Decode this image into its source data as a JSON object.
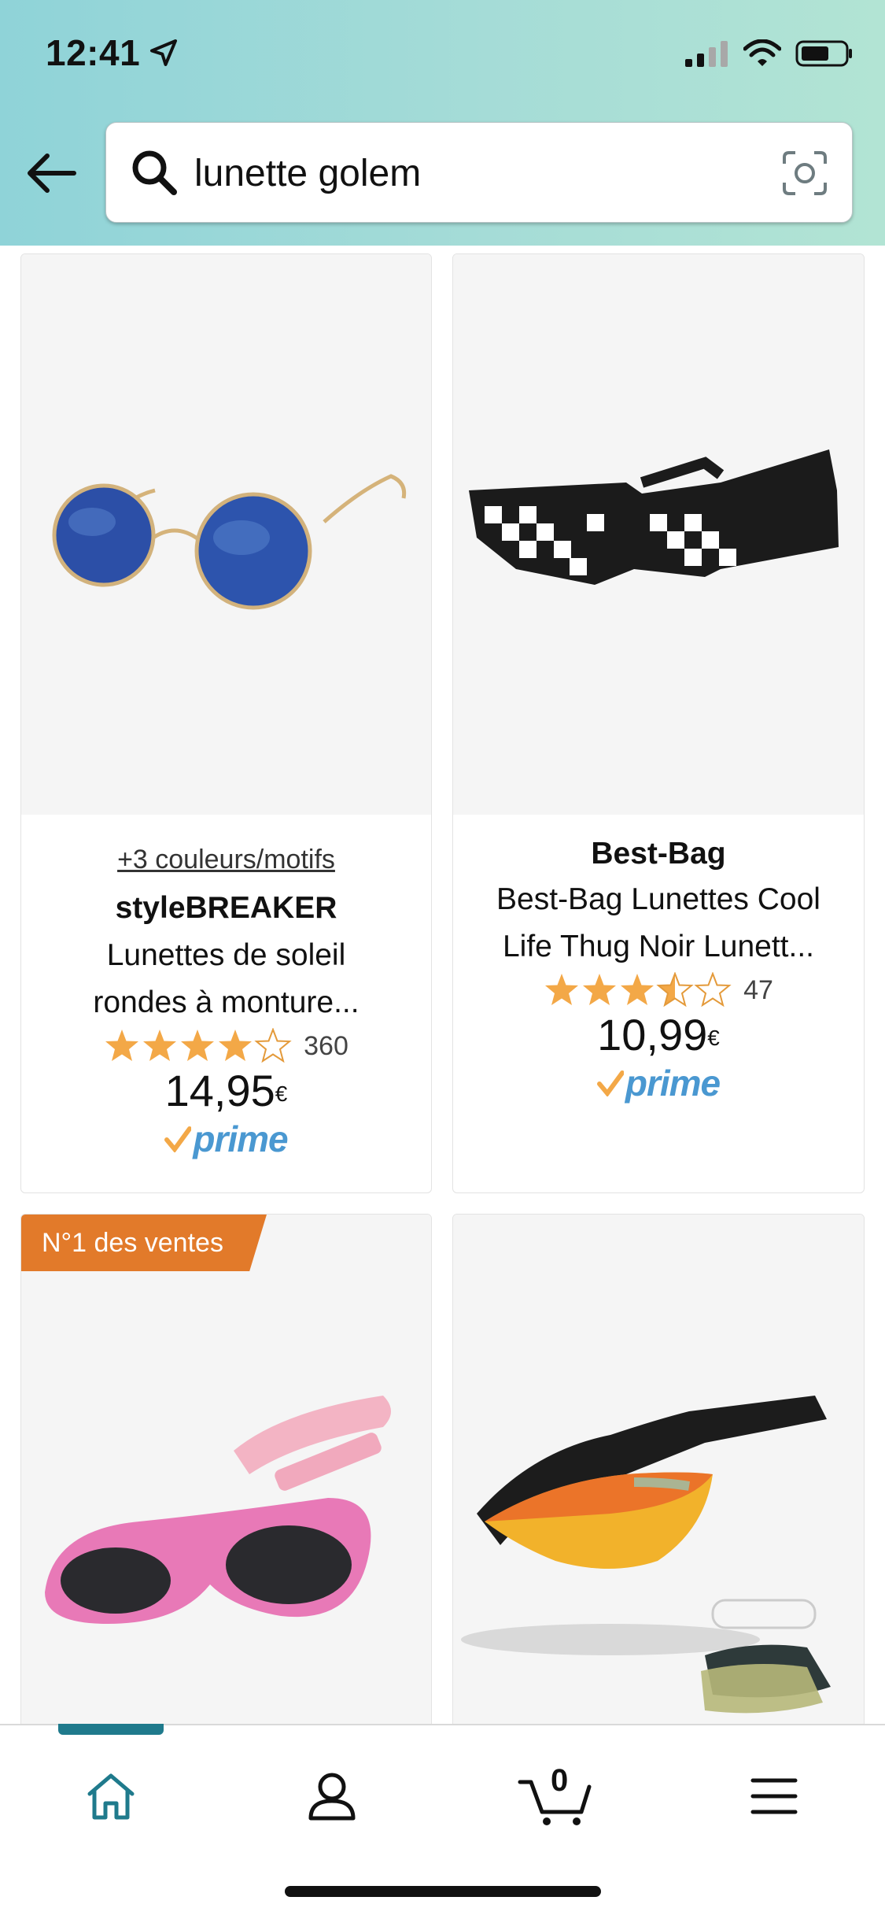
{
  "status_bar": {
    "time": "12:41",
    "location_icon": "location-arrow-icon",
    "signal_icon": "signal-icon",
    "wifi_icon": "wifi-icon",
    "battery_icon": "battery-icon"
  },
  "search": {
    "query": "lunette golem",
    "back_icon": "back-arrow-icon",
    "search_icon": "search-icon",
    "camera_icon": "camera-icon"
  },
  "products": [
    {
      "variants": "+3 couleurs/motifs",
      "brand": "styleBREAKER",
      "title_line1": "Lunettes de soleil",
      "title_line2": "rondes à monture...",
      "rating": 4.0,
      "reviews": "360",
      "price_main": "14,95",
      "currency": "€",
      "prime": "prime"
    },
    {
      "brand": "Best-Bag",
      "title_line1": "Best-Bag Lunettes Cool",
      "title_line2": "Life Thug Noir Lunett...",
      "rating": 3.5,
      "reviews": "47",
      "price_main": "10,99",
      "currency": "€",
      "prime": "prime"
    },
    {
      "badge": "N°1 des ventes"
    },
    {}
  ],
  "tab_bar": {
    "items": [
      "home-icon",
      "account-icon",
      "cart-icon",
      "menu-icon"
    ],
    "cart_count": "0",
    "active": "home"
  },
  "colors": {
    "accent": "#1f7a8c",
    "star": "#f3a847",
    "badge": "#e27a2a",
    "prime": "#4a98d1"
  }
}
